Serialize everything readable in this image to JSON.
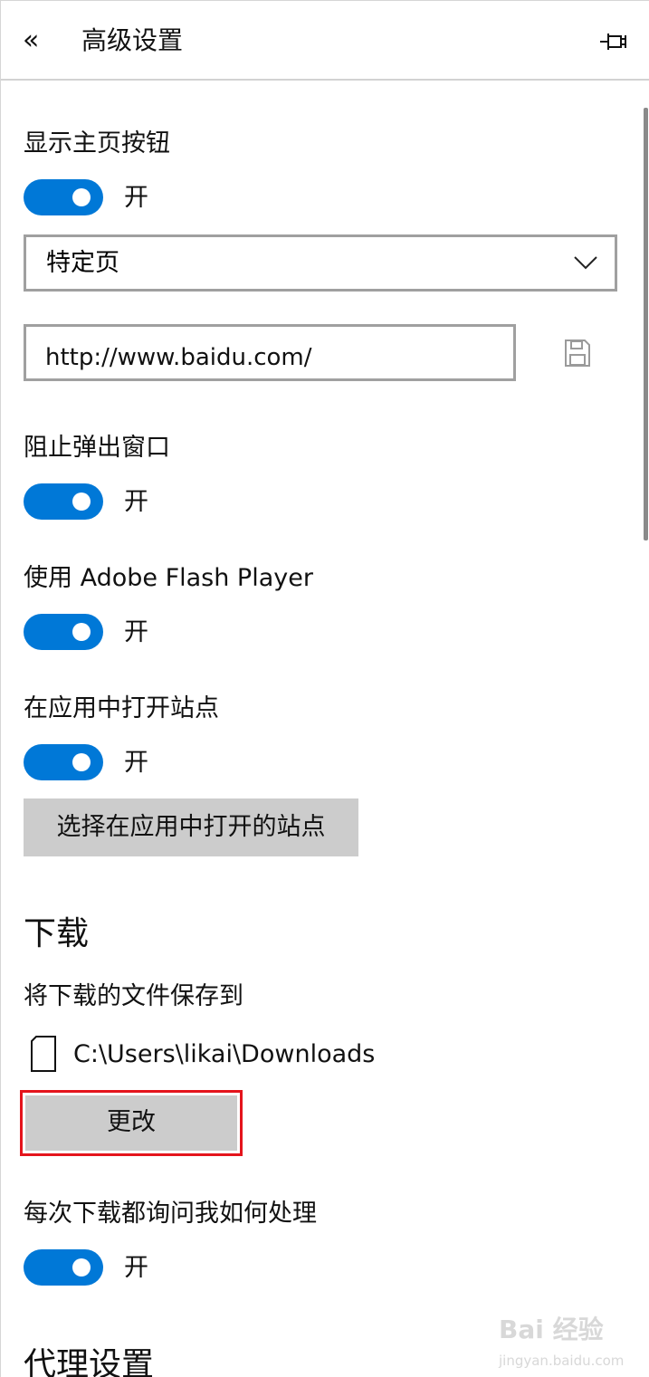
{
  "header": {
    "back_glyph": "«",
    "title": "高级设置"
  },
  "home_button": {
    "label": "显示主页按钮",
    "toggle_state": "开",
    "select_value": "特定页",
    "url_value": "http://www.baidu.com/"
  },
  "popups": {
    "label": "阻止弹出窗口",
    "toggle_state": "开"
  },
  "flash": {
    "label": "使用 Adobe Flash Player",
    "toggle_state": "开"
  },
  "open_in_app": {
    "label": "在应用中打开站点",
    "toggle_state": "开",
    "button_label": "选择在应用中打开的站点"
  },
  "downloads": {
    "heading": "下载",
    "save_to_label": "将下载的文件保存到",
    "path": "C:\\Users\\likai\\Downloads",
    "change_button": "更改",
    "ask_label": "每次下载都询问我如何处理",
    "ask_toggle_state": "开"
  },
  "proxy": {
    "heading": "代理设置"
  },
  "watermark": {
    "main": "Bai 经验",
    "sub": "jingyan.baidu.com"
  },
  "colors": {
    "accent": "#0078d7",
    "highlight": "#e4141c",
    "button_bg": "#cccccc"
  },
  "icons": [
    "back-chevron-icon",
    "pin-icon",
    "chevron-down-icon",
    "save-icon",
    "folder-icon"
  ]
}
